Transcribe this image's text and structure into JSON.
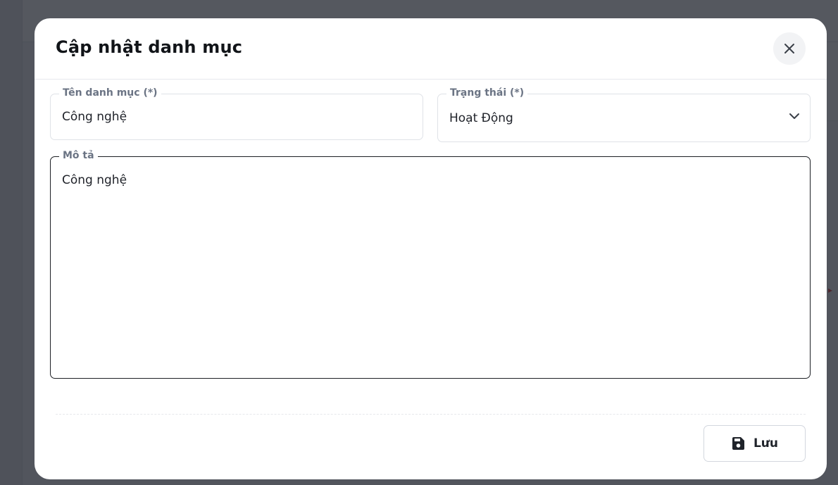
{
  "modal": {
    "title": "Cập nhật danh mục",
    "close_icon": "close-icon"
  },
  "form": {
    "name": {
      "label": "Tên danh mục (*)",
      "value": "Công nghệ"
    },
    "status": {
      "label": "Trạng thái (*)",
      "selected": "Hoạt Động",
      "icon": "chevron-down-icon"
    },
    "description": {
      "label": "Mô tả",
      "value": "Công nghệ"
    }
  },
  "footer": {
    "save_label": "Lưu",
    "save_icon": "floppy-disk-icon"
  }
}
